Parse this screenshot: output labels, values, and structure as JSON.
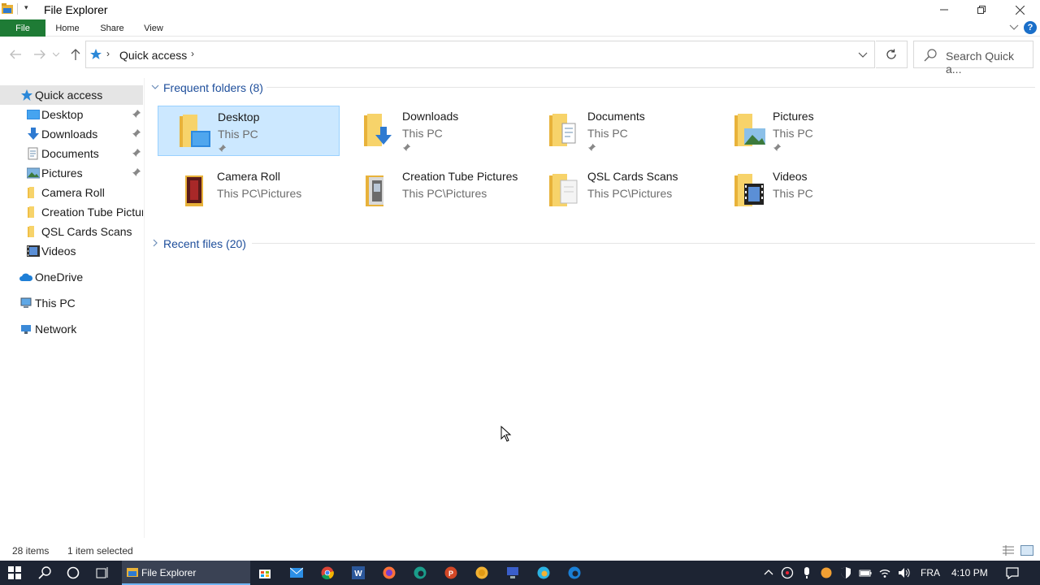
{
  "window": {
    "title": "File Explorer"
  },
  "ribbon": {
    "tabs": [
      "File",
      "Home",
      "Share",
      "View"
    ],
    "help": "?"
  },
  "address": {
    "crumb": "Quick access"
  },
  "search": {
    "placeholder": "Search Quick a..."
  },
  "sidebar": {
    "quick_access": "Quick access",
    "items": [
      "Desktop",
      "Downloads",
      "Documents",
      "Pictures",
      "Camera Roll",
      "Creation Tube Pictur",
      "QSL Cards Scans",
      "Videos"
    ],
    "onedrive": "OneDrive",
    "thispc": "This PC",
    "network": "Network"
  },
  "groups": {
    "frequent": "Frequent folders (8)",
    "recent": "Recent files (20)"
  },
  "folders": [
    {
      "name": "Desktop",
      "path": "This PC"
    },
    {
      "name": "Downloads",
      "path": "This PC"
    },
    {
      "name": "Documents",
      "path": "This PC"
    },
    {
      "name": "Pictures",
      "path": "This PC"
    },
    {
      "name": "Camera Roll",
      "path": "This PC\\Pictures"
    },
    {
      "name": "Creation Tube Pictures",
      "path": "This PC\\Pictures"
    },
    {
      "name": "QSL Cards Scans",
      "path": "This PC\\Pictures"
    },
    {
      "name": "Videos",
      "path": "This PC"
    }
  ],
  "status": {
    "items": "28 items",
    "selected": "1 item selected"
  },
  "taskbar": {
    "task_label": "File Explorer",
    "lang": "FRA",
    "time": "4:10 PM"
  },
  "colors": {
    "file_tab": "#1e7b35",
    "selection": "#cce8ff",
    "group_title": "#1e4e9b",
    "taskbar": "#1d2433"
  }
}
